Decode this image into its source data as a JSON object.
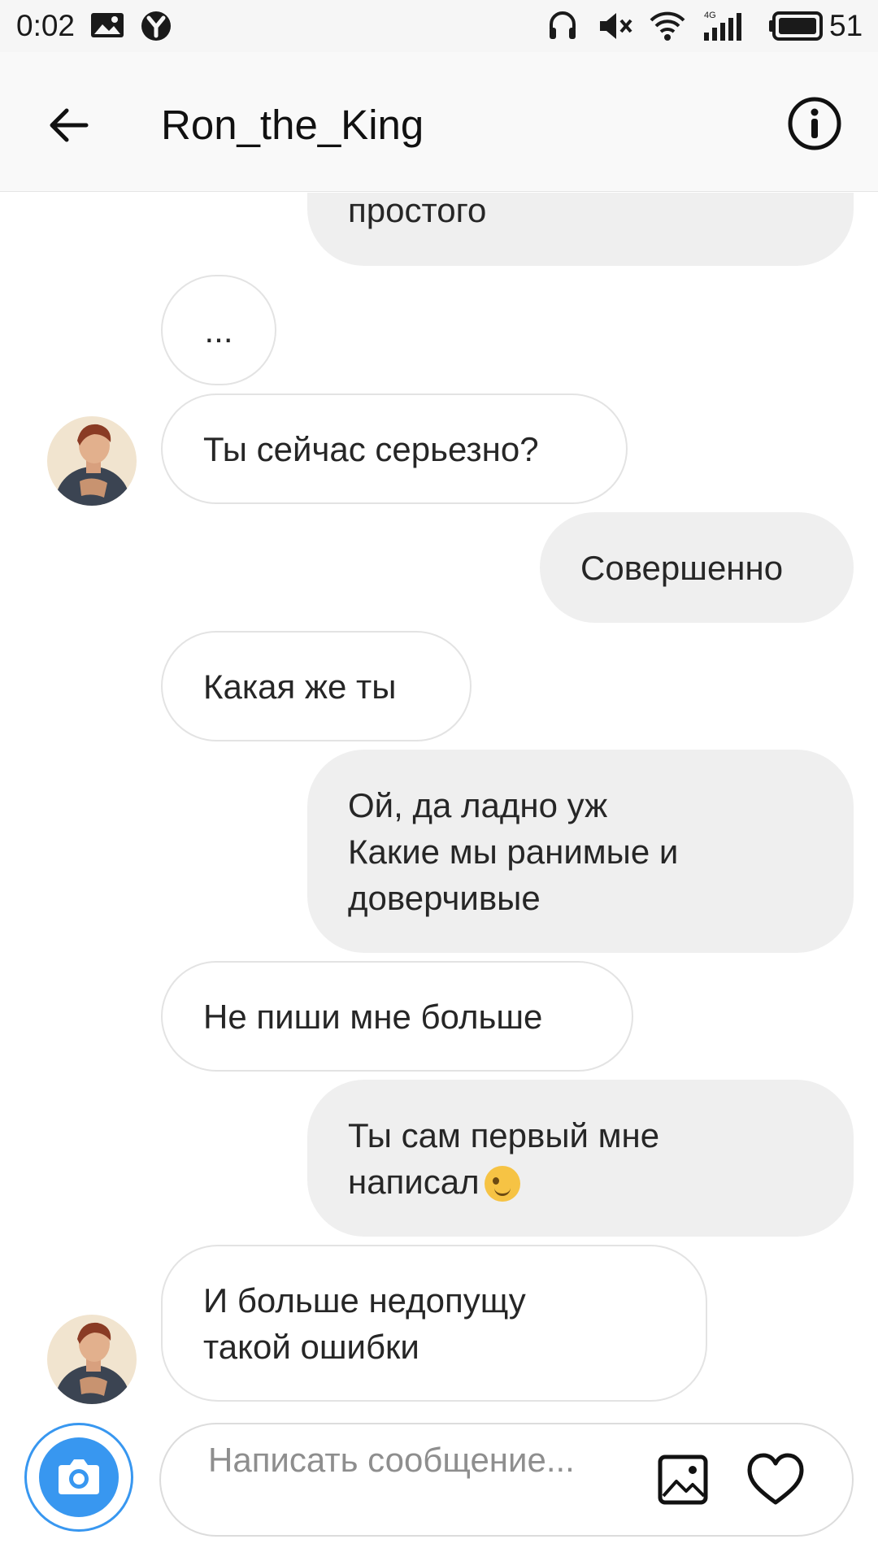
{
  "status_bar": {
    "time": "0:02",
    "battery": "51",
    "network": "4G",
    "icons": [
      "gallery-icon",
      "yandex-icon",
      "headphones-icon",
      "mute-icon",
      "wifi-icon",
      "signal-icon",
      "battery-icon"
    ]
  },
  "header": {
    "title": "Ron_the_King",
    "back_icon": "back-arrow-icon",
    "info_icon": "info-icon"
  },
  "messages": [
    {
      "from": "me",
      "text": "простого"
    },
    {
      "from": "them",
      "text": "..."
    },
    {
      "from": "them",
      "text": "Ты сейчас серьезно?"
    },
    {
      "from": "me",
      "text": "Совершенно"
    },
    {
      "from": "them",
      "text": "Какая же ты"
    },
    {
      "from": "me",
      "text": "Ой, да ладно уж\nКакие мы ранимые и\nдоверчивые"
    },
    {
      "from": "them",
      "text": "Не пиши мне больше"
    },
    {
      "from": "me",
      "text": "Ты сам первый мне\nнаписал",
      "emoji": "wink-emoji"
    },
    {
      "from": "them",
      "text": "И больше недопущу\nтакой ошибки"
    }
  ],
  "composer": {
    "placeholder": "Написать сообщение...",
    "value": "",
    "camera_icon": "camera-icon",
    "gallery_icon": "image-icon",
    "like_icon": "heart-icon",
    "accent_color": "#3897f0"
  }
}
